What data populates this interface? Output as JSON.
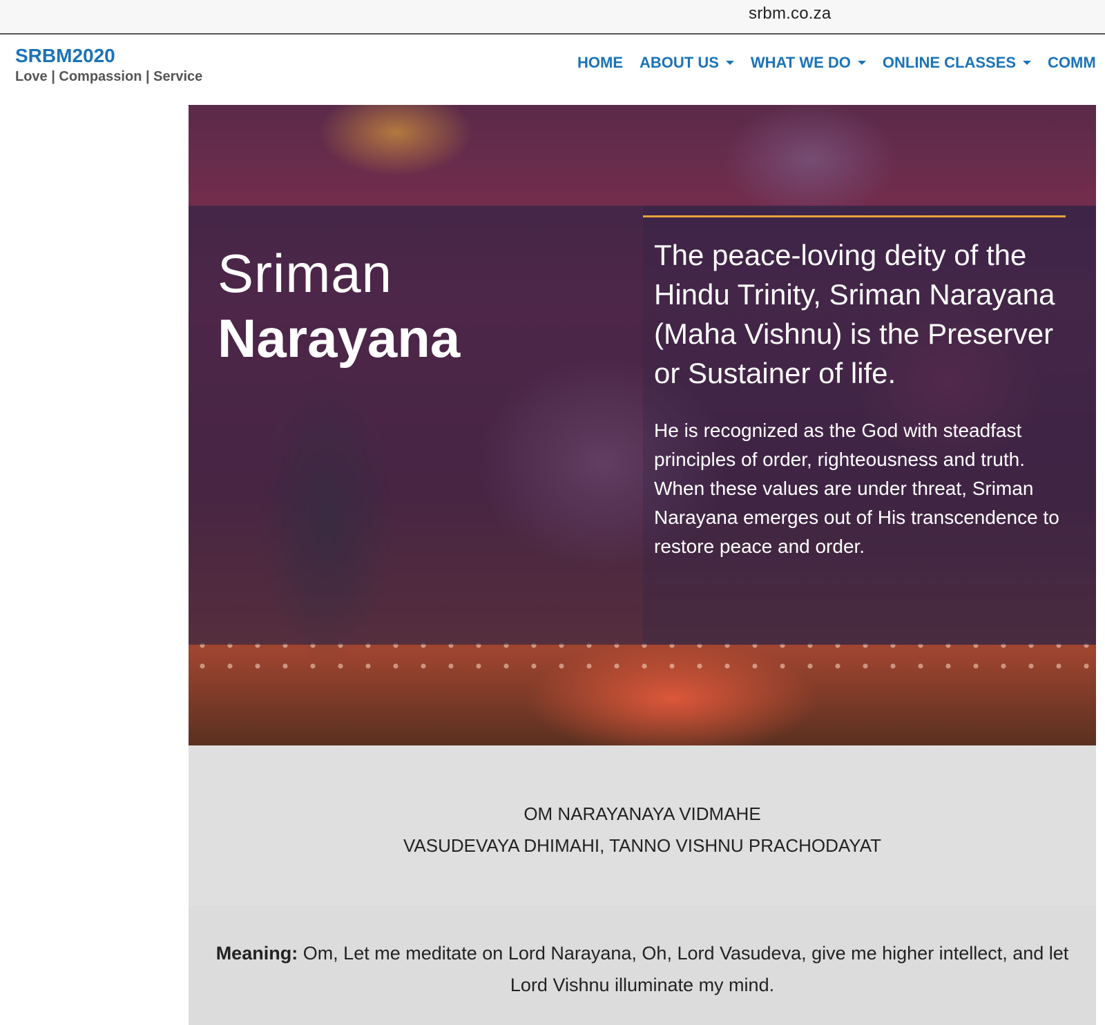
{
  "browser": {
    "url": "srbm.co.za"
  },
  "header": {
    "brand_title": "SRBM2020",
    "brand_tagline": "Love | Compassion | Service",
    "nav": [
      {
        "label": "HOME",
        "has_dropdown": false
      },
      {
        "label": "ABOUT US",
        "has_dropdown": true
      },
      {
        "label": "WHAT WE DO",
        "has_dropdown": true
      },
      {
        "label": "ONLINE CLASSES",
        "has_dropdown": true
      },
      {
        "label": "COMM",
        "has_dropdown": false
      }
    ]
  },
  "hero": {
    "title_light": "Sriman",
    "title_bold": "Narayana",
    "lead": "The peace-loving deity of the Hindu Trinity, Sriman Narayana (Maha Vishnu) is the Preserver or Sustainer of life.",
    "body": "He is recognized as the God with steadfast principles of order, righteousness and truth. When these values are under threat, Sriman Narayana emerges out of His transcendence to restore peace and order.",
    "accent_color": "#e8a33a"
  },
  "mantra": {
    "line1": "OM NARAYANAYA VIDMAHE",
    "line2": "VASUDEVAYA DHIMAHI, TANNO VISHNU PRACHODAYAT"
  },
  "meaning": {
    "label": "Meaning:",
    "text": " Om, Let me meditate on Lord Narayana, Oh, Lord Vasudeva, give me higher intellect, and let Lord Vishnu illuminate my mind."
  },
  "colors": {
    "link_blue": "#1a73b8",
    "section_grey": "#dfdfe0"
  }
}
